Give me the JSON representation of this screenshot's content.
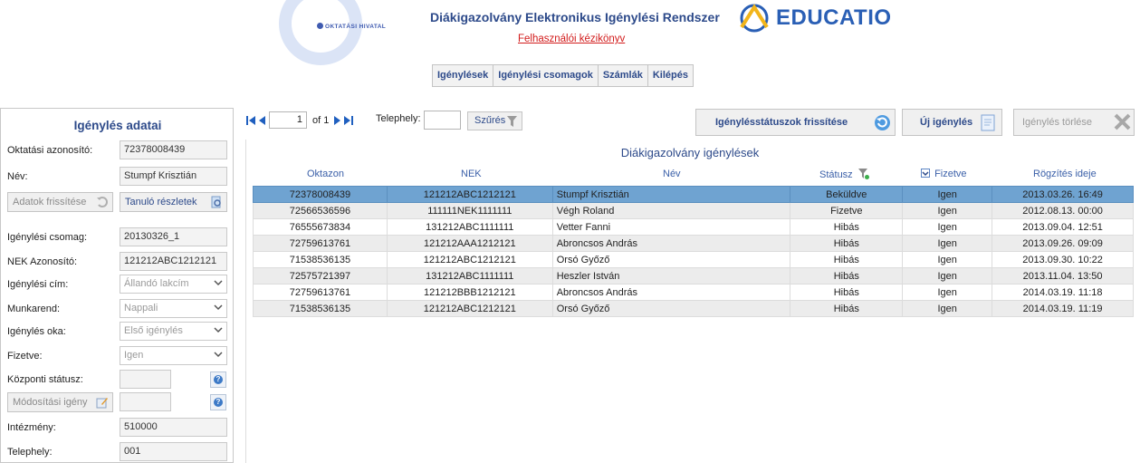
{
  "header": {
    "oktatasi_hivatal_logo": "OKTATÁSI HIVATAL",
    "title": "Diákigazolvány Elektronikus Igénylési Rendszer",
    "manual_link": "Felhasználói kézikönyv",
    "educatio_logo": "EDUCATIO",
    "nav": [
      "Igénylések",
      "Igénylési csomagok",
      "Számlák",
      "Kilépés"
    ]
  },
  "left_panel": {
    "title": "Igénylés adatai",
    "oktatasi_azonosito_label": "Oktatási azonosító:",
    "oktatasi_azonosito": "72378008439",
    "nev_label": "Név:",
    "nev": "Stumpf Krisztián",
    "adatok_frissitese": "Adatok frissítése",
    "tanulo_reszletek": "Tanuló részletek",
    "csomag_label": "Igénylési csomag:",
    "csomag": "20130326_1",
    "nek_label": "NEK Azonosító:",
    "nek": "121212ABC1212121",
    "cim_label": "Igénylési cím:",
    "cim": "Állandó lakcím",
    "munkarend_label": "Munkarend:",
    "munkarend": "Nappali",
    "oka_label": "Igénylés oka:",
    "oka": "Első igénylés",
    "fizetve_label": "Fizetve:",
    "fizetve": "Igen",
    "kozponti_label": "Központi státusz:",
    "kozponti": "",
    "modositasi_igeny": "Módosítási igény",
    "modositasi": "",
    "intezmeny_label": "Intézmény:",
    "intezmeny": "510000",
    "telephely_label": "Telephely:",
    "telephely": "001",
    "help_glyph": "?"
  },
  "toolbar": {
    "page": "1",
    "of_text": "of 1",
    "telephely_label": "Telephely:",
    "telephely_value": "",
    "szures": "Szűrés",
    "frissites": "Igénylésstátuszok frissítése",
    "uj": "Új igénylés",
    "torles": "Igénylés törlése"
  },
  "grid": {
    "title": "Diákigazolvány igénylések",
    "columns": [
      "Oktazon",
      "NEK",
      "Név",
      "Státusz",
      "Fizetve",
      "Rögzítés ideje"
    ],
    "rows": [
      [
        "72378008439",
        "121212ABC1212121",
        "Stumpf Krisztián",
        "Beküldve",
        "Igen",
        "2013.03.26. 16:49"
      ],
      [
        "72566536596",
        "111111NEK1111111",
        "Végh Roland",
        "Fizetve",
        "Igen",
        "2012.08.13. 00:00"
      ],
      [
        "76555673834",
        "131212ABC1111111",
        "Vetter Fanni",
        "Hibás",
        "Igen",
        "2013.09.04. 12:51"
      ],
      [
        "72759613761",
        "121212AAA1212121",
        "Abroncsos András",
        "Hibás",
        "Igen",
        "2013.09.26. 09:09"
      ],
      [
        "71538536135",
        "121212ABC1212121",
        "Orsó Győző",
        "Hibás",
        "Igen",
        "2013.09.30. 10:22"
      ],
      [
        "72575721397",
        "131212ABC1111111",
        "Heszler István",
        "Hibás",
        "Igen",
        "2013.11.04. 13:50"
      ],
      [
        "72759613761",
        "121212BBB1212121",
        "Abroncsos András",
        "Hibás",
        "Igen",
        "2014.03.19. 11:18"
      ],
      [
        "71538536135",
        "121212ABC1212121",
        "Orsó Győző",
        "Hibás",
        "Igen",
        "2014.03.19. 11:19"
      ]
    ],
    "selected_row": 0
  },
  "colors": {
    "accent": "#2d4a8a",
    "selected_row": "#6fa3d1",
    "link": "#d21b1b"
  }
}
